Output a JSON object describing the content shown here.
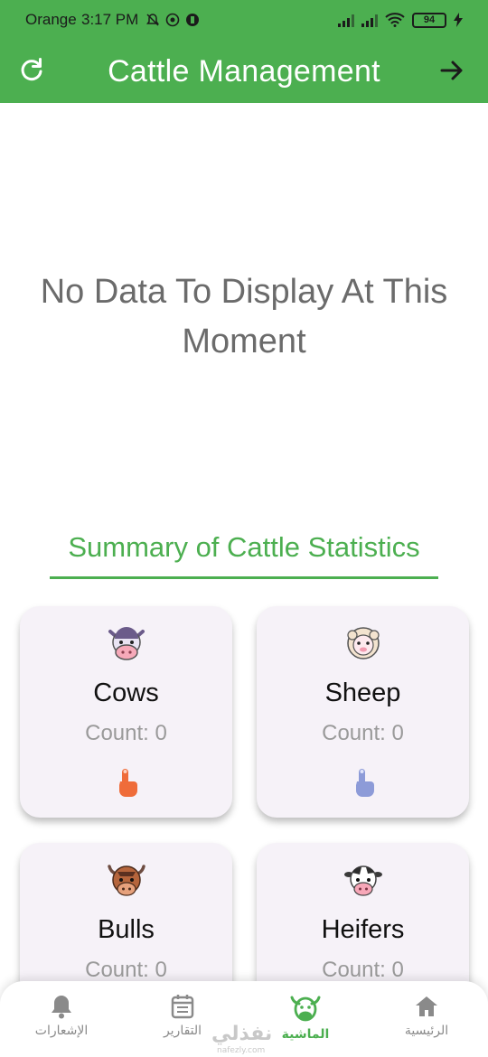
{
  "status_bar": {
    "carrier": "Orange",
    "time": "3:17 PM",
    "battery": "94"
  },
  "app_bar": {
    "title": "Cattle Management",
    "left_icon": "refresh-icon",
    "right_icon": "arrow-forward-icon"
  },
  "empty_state": {
    "line1": "No Data To Display At This",
    "line2": "Moment"
  },
  "summary": {
    "title": "Summary of Cattle Statistics"
  },
  "cards": [
    {
      "name": "Cows",
      "count": "Count: 0",
      "icon": "cow-icon",
      "tap_color": "#ef6c3a"
    },
    {
      "name": "Sheep",
      "count": "Count: 0",
      "icon": "sheep-icon",
      "tap_color": "#8d9bd8"
    },
    {
      "name": "Bulls",
      "count": "Count: 0",
      "icon": "bull-icon"
    },
    {
      "name": "Heifers",
      "count": "Count: 0",
      "icon": "heifer-icon"
    }
  ],
  "bottom_nav": {
    "items": [
      {
        "label": "الإشعارات",
        "icon": "bell-icon"
      },
      {
        "label": "التقارير",
        "icon": "calendar-icon"
      },
      {
        "label": "الماشية",
        "icon": "cow-icon",
        "active": true
      },
      {
        "label": "الرئيسية",
        "icon": "home-icon"
      }
    ]
  },
  "watermark": {
    "text": "نفذلي",
    "sub": "nafezly.com"
  },
  "colors": {
    "primary": "#4caf50",
    "card_bg": "#f6f2f8"
  }
}
